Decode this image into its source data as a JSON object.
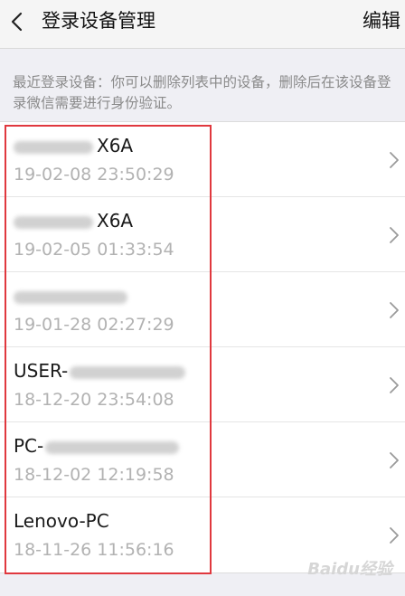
{
  "navbar": {
    "title": "登录设备管理",
    "edit_label": "编辑"
  },
  "hint": "最近登录设备：你可以删除列表中的设备，删除后在该设备登录微信需要进行身份验证。",
  "devices": [
    {
      "name": "X6A",
      "time": "19-02-08 23:50:29"
    },
    {
      "name": "X6A",
      "time": "19-02-05 01:33:54"
    },
    {
      "name": "",
      "time": "19-01-28 02:27:29"
    },
    {
      "name": "USER-",
      "time": "18-12-20 23:54:08"
    },
    {
      "name": "PC-",
      "time": "18-12-02 12:19:58"
    },
    {
      "name": "Lenovo-PC",
      "time": "18-11-26 11:56:16"
    }
  ],
  "watermark": "Baidu经验",
  "icons": {
    "back": "chevron-left-icon",
    "row": "chevron-right-icon"
  },
  "colors": {
    "highlight": "#e0383e",
    "time_text": "#b2b2b2",
    "background": "#efeff4"
  }
}
